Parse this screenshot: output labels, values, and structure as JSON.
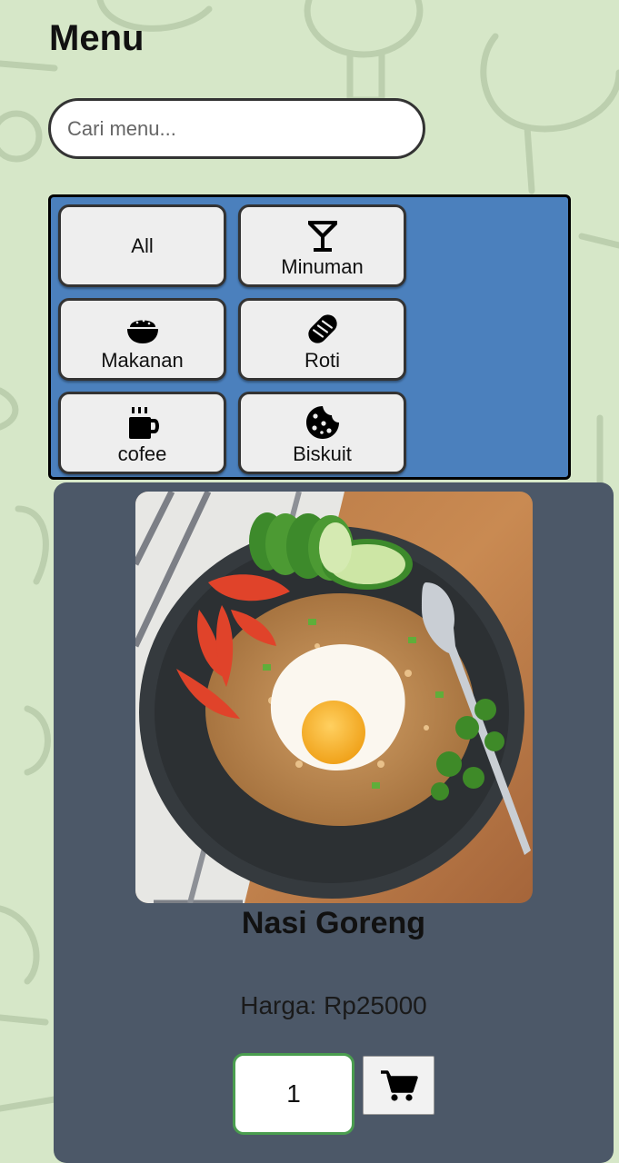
{
  "header": {
    "title": "Menu"
  },
  "search": {
    "placeholder": "Cari menu...",
    "value": ""
  },
  "categories": [
    {
      "label": "All",
      "icon": "none"
    },
    {
      "label": "Minuman",
      "icon": "cocktail-icon"
    },
    {
      "label": "Makanan",
      "icon": "rice-bowl-icon"
    },
    {
      "label": "Roti",
      "icon": "bread-icon"
    },
    {
      "label": "cofee",
      "icon": "coffee-mug-icon"
    },
    {
      "label": "Biskuit",
      "icon": "cookie-icon"
    }
  ],
  "menu_item": {
    "name": "Nasi Goreng",
    "price_text": "Harga: Rp25000",
    "quantity": "1",
    "cart_icon": "cart-icon"
  },
  "colors": {
    "background": "#d6e7c8",
    "category_panel": "#4b80bd",
    "card": "#4c5868",
    "quantity_border": "#4a9d4f"
  }
}
